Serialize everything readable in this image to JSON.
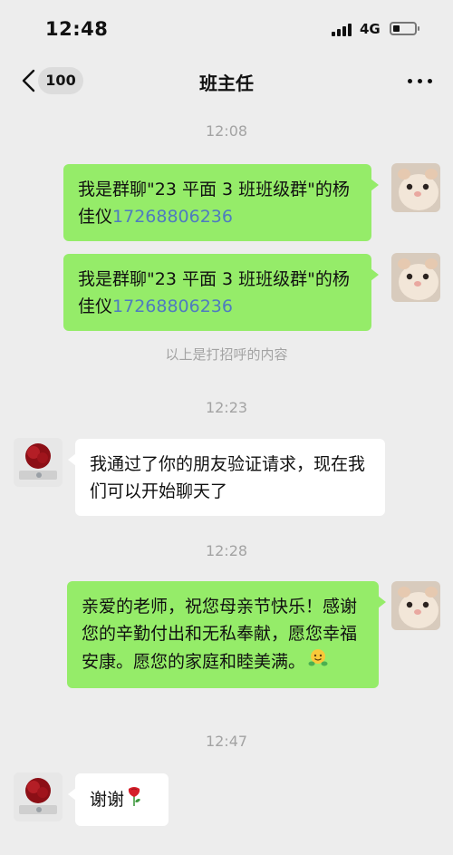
{
  "status_bar": {
    "time": "12:48",
    "network": "4G"
  },
  "nav": {
    "unread_count": "100",
    "title": "班主任",
    "icons": {
      "back": "chevron-left-icon",
      "more": "more-dots-icon"
    }
  },
  "chat": {
    "timestamps": [
      "12:08",
      "12:23",
      "12:28",
      "12:47"
    ],
    "system_notice": "以上是打招呼的内容",
    "messages": [
      {
        "sender": "me",
        "text_prefix": "我是群聊\"23 平面 3 班班级群\"的杨佳仪",
        "phone": "17268806236",
        "avatar": "hamster-avatar"
      },
      {
        "sender": "me",
        "text_prefix": "我是群聊\"23 平面 3 班班级群\"的杨佳仪",
        "phone": "17268806236",
        "avatar": "hamster-avatar"
      },
      {
        "sender": "teacher",
        "text": "我通过了你的朋友验证请求，现在我们可以开始聊天了",
        "avatar": "rose-avatar"
      },
      {
        "sender": "me",
        "text": "亲爱的老师，祝您母亲节快乐！感谢您的辛勤付出和无私奉献，愿您幸福安康。愿您的家庭和睦美满。",
        "emoji": "hugging-face-emoji",
        "avatar": "hamster-avatar"
      },
      {
        "sender": "teacher",
        "text": "谢谢",
        "emoji": "rose-emoji",
        "avatar": "rose-avatar"
      }
    ]
  },
  "colors": {
    "background": "#ededed",
    "sent_bubble": "#95ec69",
    "received_bubble": "#ffffff",
    "phone_link": "#4e7bbf",
    "timestamp": "#a3a3a3"
  }
}
